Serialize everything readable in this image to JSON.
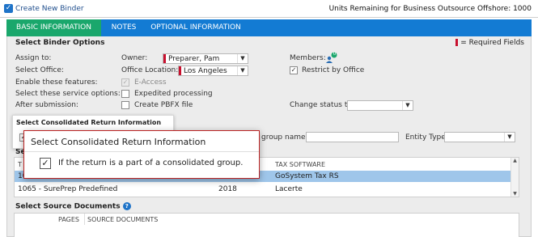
{
  "window": {
    "title": "Create New Binder",
    "units_remaining": "Units Remaining for Business Outsource Offshore: 1000"
  },
  "tabs": [
    {
      "label": "BASIC INFORMATION"
    },
    {
      "label": "NOTES"
    },
    {
      "label": "OPTIONAL INFORMATION"
    }
  ],
  "binder_options": {
    "section_title": "Select Binder Options",
    "required_legend": "= Required Fields",
    "assign_to_label": "Assign to:",
    "select_office_label": "Select Office:",
    "enable_features_label": "Enable these features:",
    "service_options_label": "Select these service options:",
    "after_submission_label": "After submission:",
    "owner_label": "Owner:",
    "owner_value": "Preparer, Pam",
    "office_location_label": "Office Location:",
    "office_location_value": "Los Angeles",
    "e_access_label": "E-Access",
    "expedited_label": "Expedited processing",
    "create_pbfx_label": "Create PBFX file",
    "members_label": "Members:",
    "members_count": "0",
    "restrict_label": "Restrict by Office",
    "change_status_label": "Change status to:",
    "change_status_value": ""
  },
  "consolidated": {
    "section_title": "Select Consolidated Return Information",
    "group_name_label": "group name:",
    "entity_type_label": "Entity Type:"
  },
  "tooltip": {
    "title": "Select Consolidated Return Information",
    "checkbox_label": "If the return is a part of a consolidated group."
  },
  "template": {
    "section_title_fragment": "Sele",
    "col_fragment": "T",
    "tax_software_header": "TAX SOFTWARE",
    "rows": [
      {
        "name": "10",
        "year": "",
        "software": "GoSystem Tax RS"
      },
      {
        "name": "1065 - SurePrep Predefined",
        "year": "2018",
        "software": "Lacerte"
      }
    ]
  },
  "source_docs": {
    "section_title": "Select Source Documents",
    "help_icon": "?",
    "columns": [
      "PAGES",
      "SOURCE DOCUMENTS"
    ]
  }
}
